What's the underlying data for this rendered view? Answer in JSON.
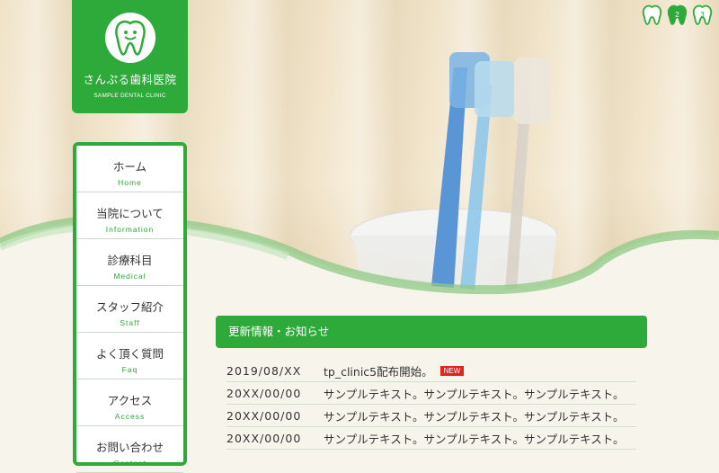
{
  "brand": {
    "name": "さんぷる歯科医院",
    "sub": "SAMPLE DENTAL CLINIC",
    "icon": "tooth-logo-icon",
    "accent": "#2eaa3a"
  },
  "slider": {
    "indicators": [
      {
        "label": "",
        "state": "outline"
      },
      {
        "label": "2",
        "state": "filled"
      },
      {
        "label": "3",
        "state": "outline"
      }
    ]
  },
  "nav": {
    "items": [
      {
        "jp": "ホーム",
        "en": "Home"
      },
      {
        "jp": "当院について",
        "en": "Information"
      },
      {
        "jp": "診療科目",
        "en": "Medical"
      },
      {
        "jp": "スタッフ紹介",
        "en": "Staff"
      },
      {
        "jp": "よく頂く質問",
        "en": "Faq"
      },
      {
        "jp": "アクセス",
        "en": "Access"
      },
      {
        "jp": "お問い合わせ",
        "en": "Contact"
      }
    ]
  },
  "news": {
    "title": "更新情報・お知らせ",
    "items": [
      {
        "date": "2019/08/XX",
        "text": "tp_clinic5配布開始。",
        "badge": "NEW"
      },
      {
        "date": "20XX/00/00",
        "text": "サンプルテキスト。サンプルテキスト。サンプルテキスト。",
        "badge": ""
      },
      {
        "date": "20XX/00/00",
        "text": "サンプルテキスト。サンプルテキスト。サンプルテキスト。",
        "badge": ""
      },
      {
        "date": "20XX/00/00",
        "text": "サンプルテキスト。サンプルテキスト。サンプルテキスト。",
        "badge": ""
      }
    ]
  }
}
